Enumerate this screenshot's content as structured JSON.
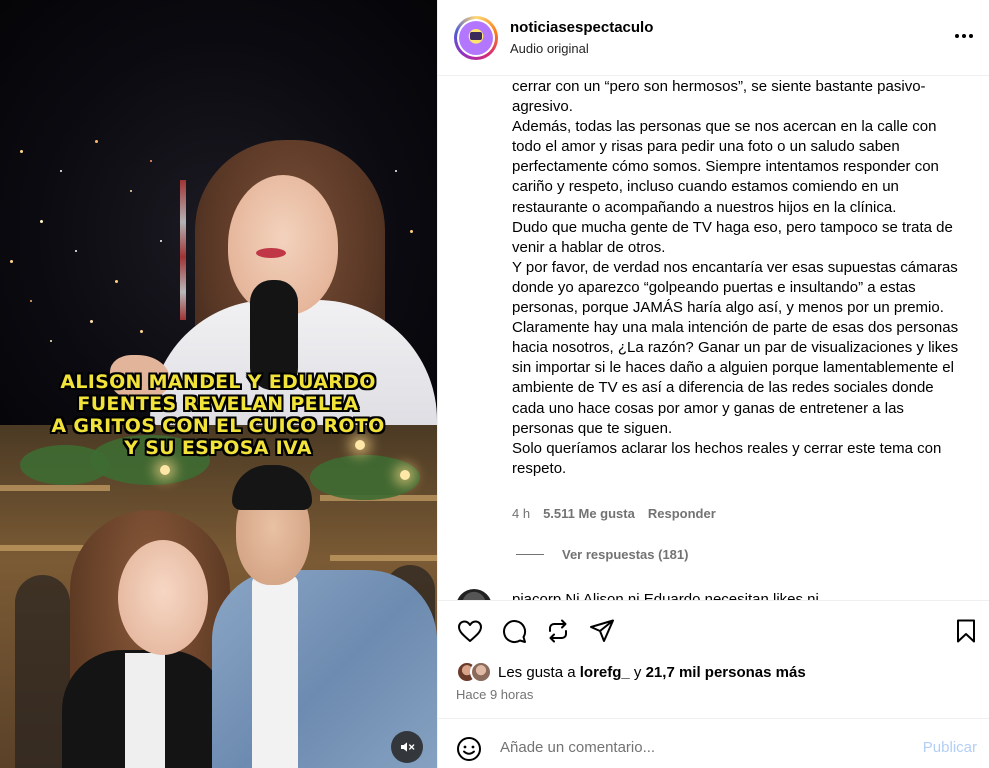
{
  "post": {
    "username": "noticiasespectaculo",
    "audio": "Audio original"
  },
  "media": {
    "caption_lines": [
      "ALISON MANDEL Y EDUARDO",
      "FUENTES REVELAN PELEA",
      "A GRITOS CON EL CUICO ROTO",
      "Y SU ESPOSA IVA"
    ],
    "mute_icon": "speaker-muted-icon"
  },
  "comment": {
    "paragraphs": [
      "cerrar con un “pero son hermosos”, se siente bastante pasivo-agresivo.",
      "Además, todas las personas que se nos acercan en la calle con todo el amor y risas para pedir una foto o un saludo saben perfectamente cómo somos. Siempre intentamos responder con cariño y respeto, incluso cuando estamos comiendo en un restaurante o acompañando a nuestros hijos en la clínica.",
      "Dudo que mucha gente de TV haga eso, pero tampoco se trata de venir a hablar de otros.",
      "Y por favor, de verdad nos encantaría ver esas supuestas cámaras donde yo aparezco “golpeando puertas e insultando” a estas personas, porque JAMÁS haría algo así, y menos por un premio.",
      "Claramente hay una mala intención de parte de esas dos personas hacia nosotros, ¿La razón? Ganar un par de visualizaciones y likes sin importar si le haces daño a alguien porque lamentablemente el ambiente de TV es así a diferencia de las redes sociales donde cada uno hace cosas por amor y ganas de entretener a las personas que te siguen.",
      "Solo queríamos aclarar los hechos reales y cerrar este tema con respeto."
    ],
    "time": "4 h",
    "likes": "5.511 Me gusta",
    "reply": "Responder",
    "view_replies": "Ver respuestas (181)"
  },
  "next_comment": {
    "text": "piacorp Ni Alison ni Eduardo necesitan likes ni"
  },
  "actions": {
    "likes_prefix": "Les gusta a",
    "liker": "lorefg_",
    "connector": "y",
    "others": "21,7 mil personas más",
    "time_ago": "Hace 9 horas"
  },
  "add_comment": {
    "placeholder": "Añade un comentario...",
    "publish": "Publicar"
  },
  "colors": {
    "caption": "#f2e33a",
    "publish_disabled": "#b3cff5",
    "secondary_text": "#737373"
  }
}
